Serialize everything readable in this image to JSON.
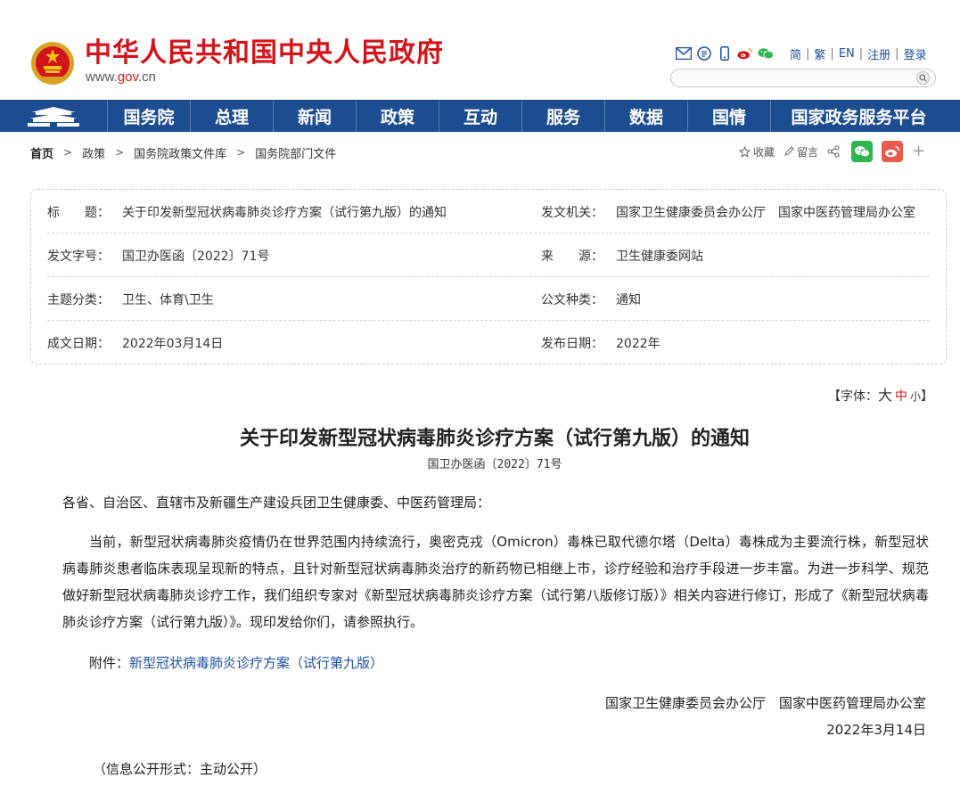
{
  "header": {
    "site_title": "中华人民共和国中央人民政府",
    "url_prefix": "www.",
    "url_domain": "gov",
    "url_suffix": ".cn",
    "icons": [
      "mail-icon",
      "rss-icon",
      "mobile-icon",
      "weibo-icon",
      "wechat-icon"
    ],
    "lang_links": [
      "简",
      "繁",
      "EN",
      "注册",
      "登录"
    ],
    "search_placeholder": ""
  },
  "nav": {
    "items": [
      "国务院",
      "总理",
      "新闻",
      "政策",
      "互动",
      "服务",
      "数据",
      "国情",
      "国家政务服务平台"
    ]
  },
  "breadcrumb": {
    "items": [
      "首页",
      "政策",
      "国务院政策文件库",
      "国务院部门文件"
    ]
  },
  "share": {
    "favorite": "收藏",
    "comment": "留言",
    "plus": "+"
  },
  "info": {
    "rows": [
      {
        "l1": "标　　题：",
        "v1": "关于印发新型冠状病毒肺炎诊疗方案（试行第九版）的通知",
        "l2": "发文机关：",
        "v2": "国家卫生健康委员会办公厅　国家中医药管理局办公室"
      },
      {
        "l1": "发文字号：",
        "v1": "国卫办医函〔2022〕71号",
        "l2": "来　　源：",
        "v2": "卫生健康委网站"
      },
      {
        "l1": "主题分类：",
        "v1": "卫生、体育\\卫生",
        "l2": "公文种类：",
        "v2": "通知"
      },
      {
        "l1": "成文日期：",
        "v1": "2022年03月14日",
        "l2": "发布日期：",
        "v2": "2022年"
      }
    ]
  },
  "font_size": {
    "prefix": "【字体：",
    "big": "大",
    "mid": "中",
    "small": "小",
    "suffix": "】"
  },
  "article": {
    "title": "关于印发新型冠状病毒肺炎诊疗方案（试行第九版）的通知",
    "doc_no": "国卫办医函〔2022〕71号",
    "greeting": "各省、自治区、直辖市及新疆生产建设兵团卫生健康委、中医药管理局：",
    "body": "当前，新型冠状病毒肺炎疫情仍在世界范围内持续流行，奥密克戎（Omicron）毒株已取代德尔塔（Delta）毒株成为主要流行株，新型冠状病毒肺炎患者临床表现呈现新的特点，且针对新型冠状病毒肺炎治疗的新药物已相继上市，诊疗经验和治疗手段进一步丰富。为进一步科学、规范做好新型冠状病毒肺炎诊疗工作，我们组织专家对《新型冠状病毒肺炎诊疗方案（试行第八版修订版）》相关内容进行修订，形成了《新型冠状病毒肺炎诊疗方案（试行第九版）》。现印发给你们，请参照执行。",
    "attach_label": "附件：",
    "attach_link": "新型冠状病毒肺炎诊疗方案（试行第九版）",
    "signature": "国家卫生健康委员会办公厅　国家中医药管理局办公室",
    "date": "2022年3月14日",
    "disclosure": "（信息公开形式：主动公开）"
  }
}
